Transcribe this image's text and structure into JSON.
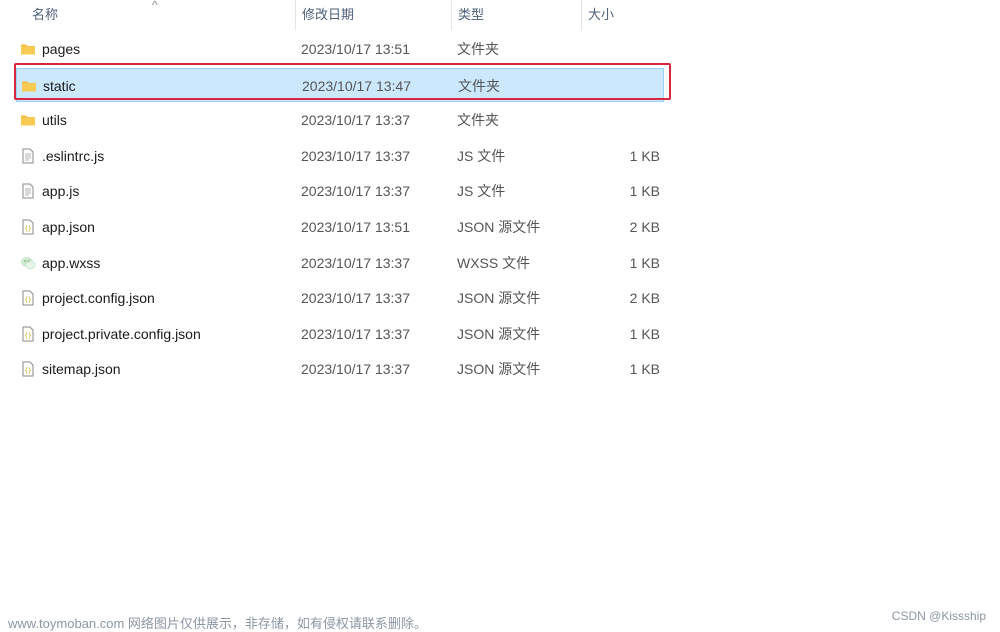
{
  "columns": {
    "name": "名称",
    "date": "修改日期",
    "type": "类型",
    "size": "大小"
  },
  "sort_indicator": "^",
  "files": [
    {
      "name": "pages",
      "date": "2023/10/17 13:51",
      "type": "文件夹",
      "size": "",
      "icon": "folder-icon",
      "selected": false
    },
    {
      "name": "static",
      "date": "2023/10/17 13:47",
      "type": "文件夹",
      "size": "",
      "icon": "folder-icon",
      "selected": true
    },
    {
      "name": "utils",
      "date": "2023/10/17 13:37",
      "type": "文件夹",
      "size": "",
      "icon": "folder-icon",
      "selected": false
    },
    {
      "name": ".eslintrc.js",
      "date": "2023/10/17 13:37",
      "type": "JS 文件",
      "size": "1 KB",
      "icon": "js-file-icon",
      "selected": false
    },
    {
      "name": "app.js",
      "date": "2023/10/17 13:37",
      "type": "JS 文件",
      "size": "1 KB",
      "icon": "js-file-icon",
      "selected": false
    },
    {
      "name": "app.json",
      "date": "2023/10/17 13:51",
      "type": "JSON 源文件",
      "size": "2 KB",
      "icon": "json-file-icon",
      "selected": false
    },
    {
      "name": "app.wxss",
      "date": "2023/10/17 13:37",
      "type": "WXSS 文件",
      "size": "1 KB",
      "icon": "wechat-file-icon",
      "selected": false
    },
    {
      "name": "project.config.json",
      "date": "2023/10/17 13:37",
      "type": "JSON 源文件",
      "size": "2 KB",
      "icon": "json-file-icon",
      "selected": false
    },
    {
      "name": "project.private.config.json",
      "date": "2023/10/17 13:37",
      "type": "JSON 源文件",
      "size": "1 KB",
      "icon": "json-file-icon",
      "selected": false
    },
    {
      "name": "sitemap.json",
      "date": "2023/10/17 13:37",
      "type": "JSON 源文件",
      "size": "1 KB",
      "icon": "json-file-icon",
      "selected": false
    }
  ],
  "watermark": {
    "left": "www.toymoban.com 网络图片仅供展示，非存储，如有侵权请联系删除。",
    "right": "CSDN @Kissship"
  },
  "colors": {
    "selection_bg": "#cce8ff",
    "annotation_red": "#d7263d",
    "folder": "#f8cc52"
  }
}
